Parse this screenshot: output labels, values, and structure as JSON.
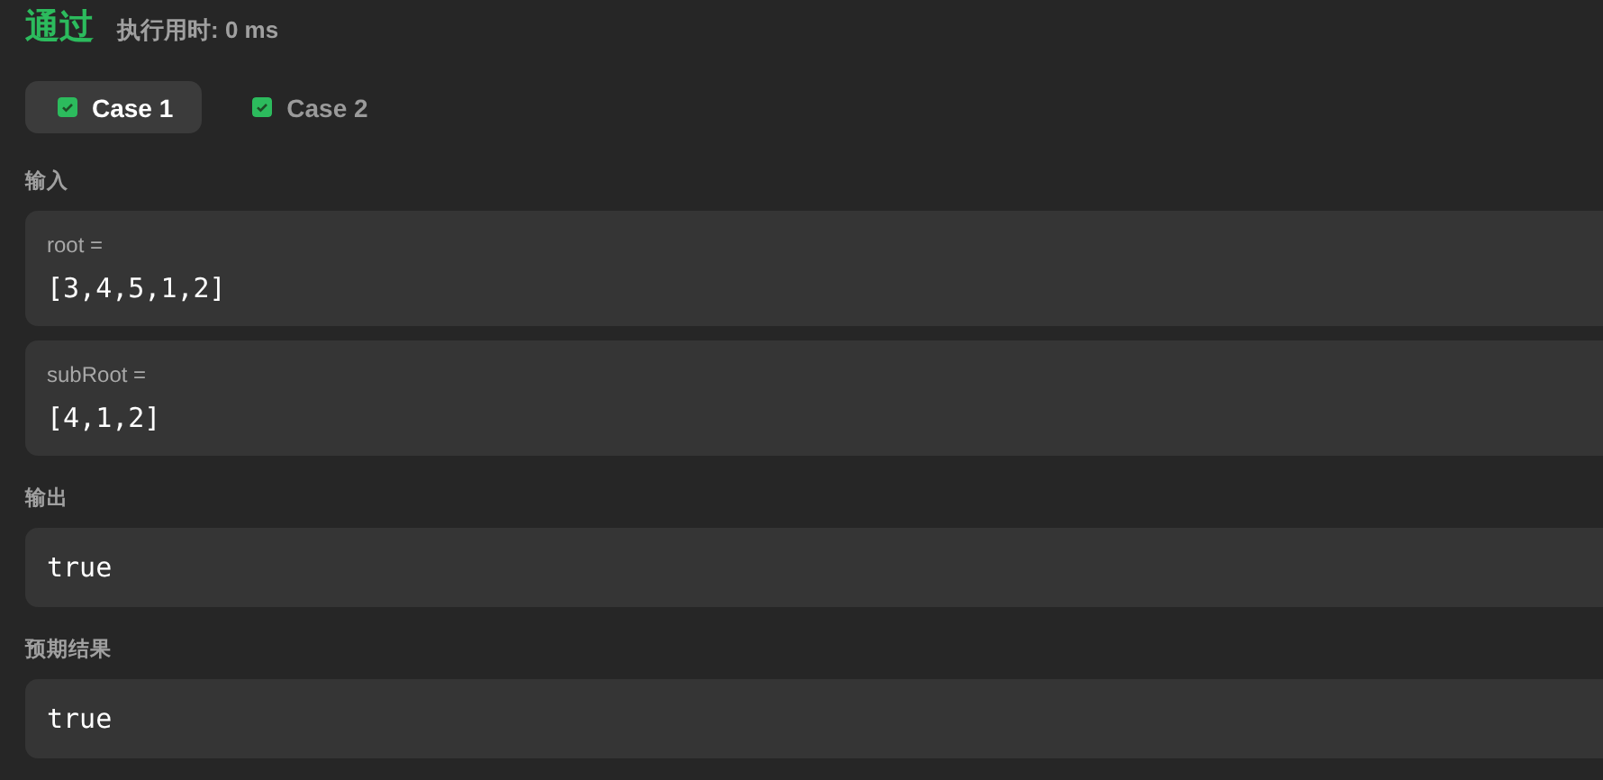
{
  "result": {
    "status": "通过",
    "runtime": "执行用时: 0 ms"
  },
  "cases": [
    {
      "label": "Case 1",
      "selected": true,
      "checked": true
    },
    {
      "label": "Case 2",
      "selected": false,
      "checked": true
    }
  ],
  "input": {
    "heading": "输入",
    "params": [
      {
        "name": "root =",
        "value": "[3,4,5,1,2]"
      },
      {
        "name": "subRoot =",
        "value": "[4,1,2]"
      }
    ]
  },
  "output": {
    "heading": "输出",
    "value": "true"
  },
  "expected": {
    "heading": "预期结果",
    "value": "true"
  }
}
